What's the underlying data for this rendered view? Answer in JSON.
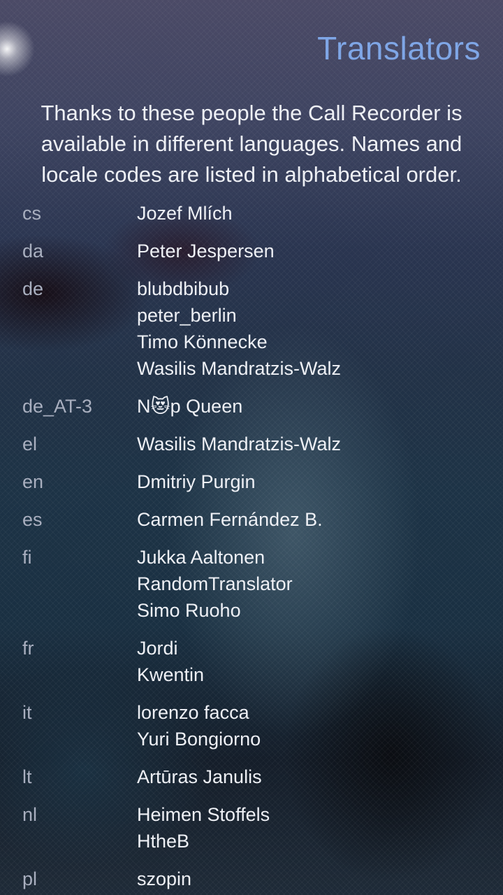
{
  "header": {
    "title": "Translators"
  },
  "intro": "Thanks to these people the Call Recorder is available in different languages. Names and locale codes are listed in alphabetical order.",
  "translators": [
    {
      "code": "cs",
      "names": [
        "Jozef Mlích"
      ]
    },
    {
      "code": "da",
      "names": [
        "Peter Jespersen"
      ]
    },
    {
      "code": "de",
      "names": [
        "blubdbibub",
        "peter_berlin",
        "Timo Könnecke",
        "Wasilis Mandratzis-Walz"
      ]
    },
    {
      "code": "de_AT-3",
      "names": [
        "N😻p Queen"
      ]
    },
    {
      "code": "el",
      "names": [
        "Wasilis Mandratzis-Walz"
      ]
    },
    {
      "code": "en",
      "names": [
        "Dmitriy Purgin"
      ]
    },
    {
      "code": "es",
      "names": [
        "Carmen Fernández B."
      ]
    },
    {
      "code": "fi",
      "names": [
        "Jukka Aaltonen",
        "RandomTranslator",
        "Simo Ruoho"
      ]
    },
    {
      "code": "fr",
      "names": [
        "Jordi",
        "Kwentin"
      ]
    },
    {
      "code": "it",
      "names": [
        "lorenzo facca",
        "Yuri Bongiorno"
      ]
    },
    {
      "code": "lt",
      "names": [
        "Artūras Janulis"
      ]
    },
    {
      "code": "nl",
      "names": [
        "Heimen Stoffels",
        "HtheB"
      ]
    },
    {
      "code": "pl",
      "names": [
        "szopin"
      ]
    }
  ],
  "colors": {
    "accent": "#7fa6e6",
    "primary_text": "#eef0f5",
    "secondary_text": "#a9afbf"
  }
}
